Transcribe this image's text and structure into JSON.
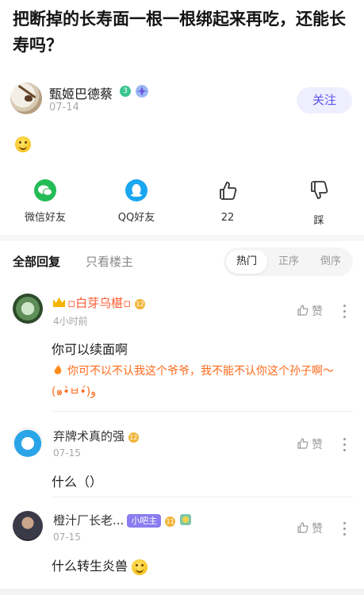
{
  "post": {
    "title": "把断掉的长寿面一根一根绑起来再吃，还能长寿吗？",
    "author": {
      "name": "甄姬巴德蔡",
      "level": "3",
      "date": "07-14"
    },
    "follow_label": "关注",
    "body_emoji": "smile-emoji"
  },
  "actions": {
    "wechat": "微信好友",
    "qq": "QQ好友",
    "like_count": "22",
    "dislike": "踩"
  },
  "tabs": {
    "all": "全部回复",
    "host_only": "只看楼主",
    "sort": [
      "热门",
      "正序",
      "倒序"
    ],
    "active_sort": "热门"
  },
  "comments": [
    {
      "name": "▫白芽乌椹▫",
      "level": "12",
      "time": "4小时前",
      "text": "你可以续面啊",
      "quote": "你可不以不认我这个爷爷，我不能不认你这个孙子啊～(๑•̀ㅂ•́)و",
      "like": "赞"
    },
    {
      "name": "弃牌术真的强",
      "level": "12",
      "time": "07-15",
      "text": "什么（）",
      "like": "赞"
    },
    {
      "name": "橙汁厂长老...",
      "role": "小吧主",
      "level": "11",
      "time": "07-15",
      "text": "什么转生炎兽",
      "like": "赞"
    }
  ],
  "colors": {
    "accent": "#5a55e6",
    "vip": "#ff5c33",
    "quote": "#ff6a1a"
  }
}
